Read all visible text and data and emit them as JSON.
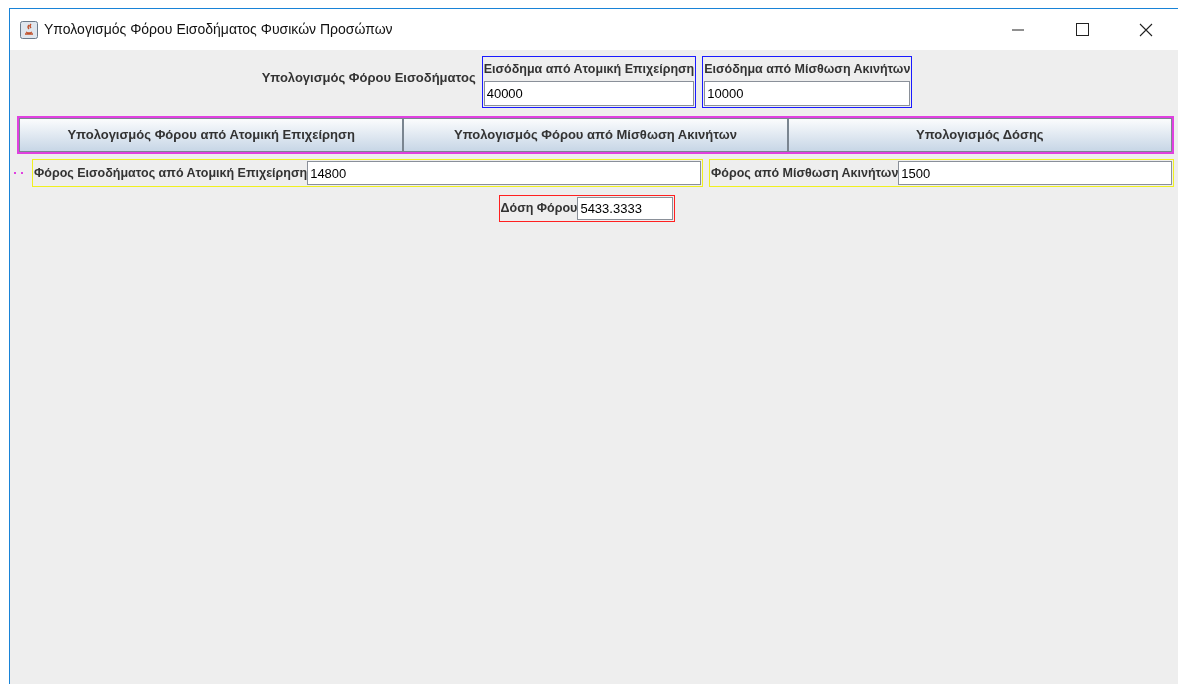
{
  "window": {
    "title": "Υπολογισμός Φόρου Εισοδήματος Φυσικών Προσώπων"
  },
  "heading": "Υπολογισμός Φόρου Εισοδήματος",
  "inputs": [
    {
      "label": "Εισόδημα από Ατομική Επιχείρηση",
      "value": "40000"
    },
    {
      "label": "Εισόδημα από Μίσθωση Ακινήτων",
      "value": "10000"
    }
  ],
  "buttons": [
    "Υπολογισμός Φόρου από Ατομική Επιχείρηση",
    "Υπολογισμός Φόρου από Μίσθωση Ακινήτων",
    "Υπολογισμός Δόσης"
  ],
  "results": [
    {
      "label": "Φόρος Εισοδήματος από Ατομική Επιχείρηση",
      "value": "14800"
    },
    {
      "label": "Φόρος από Μίσθωση Ακινήτων",
      "value": "1500"
    }
  ],
  "installment": {
    "label": "Δόση Φόρου",
    "value": "5433.3333"
  }
}
